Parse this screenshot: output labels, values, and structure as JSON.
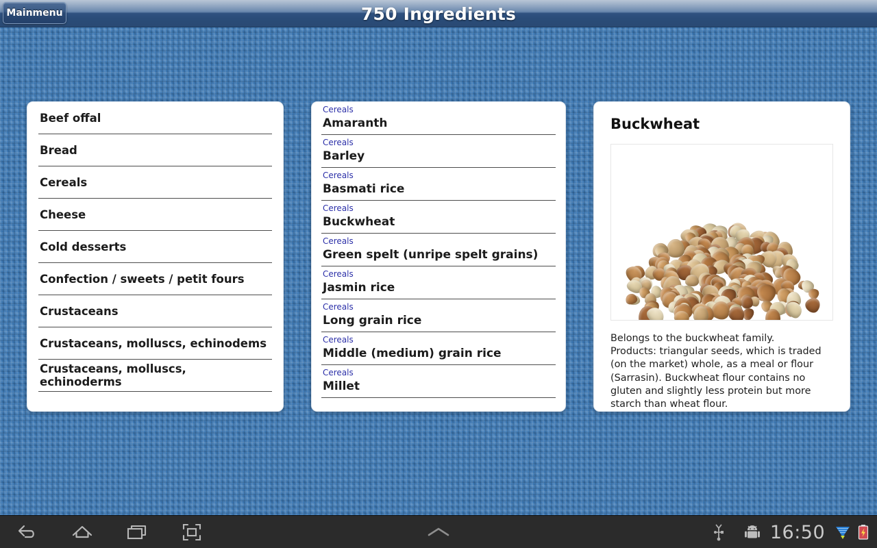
{
  "header": {
    "title": "750 Ingredients",
    "mainmenu_label": "Mainmenu"
  },
  "categories": {
    "items": [
      {
        "label": "Beef offal"
      },
      {
        "label": "Bread"
      },
      {
        "label": "Cereals"
      },
      {
        "label": "Cheese"
      },
      {
        "label": "Cold desserts"
      },
      {
        "label": "Confection / sweets / petit fours"
      },
      {
        "label": "Crustaceans"
      },
      {
        "label": "Crustaceans, molluscs, echinodems"
      },
      {
        "label": "Crustaceans, molluscs, echinoderms"
      }
    ]
  },
  "ingredients": {
    "items": [
      {
        "category": "Cereals",
        "name": "Amaranth"
      },
      {
        "category": "Cereals",
        "name": "Barley"
      },
      {
        "category": "Cereals",
        "name": "Basmati rice"
      },
      {
        "category": "Cereals",
        "name": "Buckwheat"
      },
      {
        "category": "Cereals",
        "name": "Green spelt (unripe spelt grains)"
      },
      {
        "category": "Cereals",
        "name": "Jasmin rice"
      },
      {
        "category": "Cereals",
        "name": "Long grain rice"
      },
      {
        "category": "Cereals",
        "name": "Middle (medium) grain rice"
      },
      {
        "category": "Cereals",
        "name": "Millet"
      }
    ]
  },
  "detail": {
    "title": "Buckwheat",
    "image_name": "buckwheat-groats-photo",
    "description": "Belongs to the buckwheat family.\nProducts: triangular seeds, which is traded (on the market) whole, as a meal or flour (Sarrasin). Buckwheat flour contains no gluten and slightly less protein but more starch than wheat flour."
  },
  "system_bar": {
    "back_icon": "back-arrow-icon",
    "home_icon": "home-icon",
    "recents_icon": "recent-apps-icon",
    "expand_icon": "fullscreen-icon",
    "chevron_icon": "chevron-up-icon",
    "usb_icon": "usb-icon",
    "android_icon": "android-robot-icon",
    "clock": "16:50",
    "wifi_icon": "wifi-signal-icon",
    "battery_icon": "battery-charging-icon"
  },
  "colors": {
    "background_blue": "#3d79b5",
    "header_dark": "#2a4a74",
    "card_white": "#ffffff",
    "category_link_blue": "#2b2fa8",
    "text_dark": "#1b1b1b",
    "system_bar": "#2b2b2b",
    "clock_gray": "#c9c9c9"
  }
}
